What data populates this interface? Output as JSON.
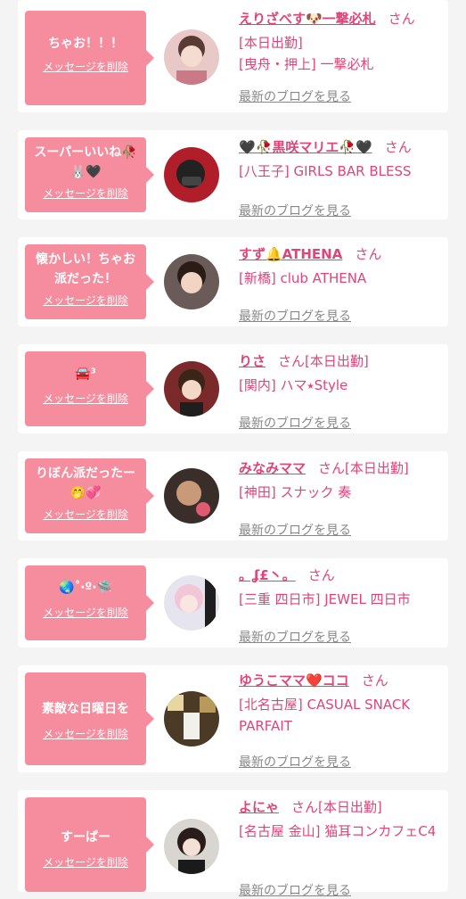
{
  "delete_label": "メッセージを削除",
  "blog_label": "最新のブログを見る",
  "san_label": "さん",
  "colors": {
    "bubble": "#f68d9e",
    "accent": "#e0457a",
    "link_gray": "#888888"
  },
  "cards": [
    {
      "message": "ちゃお！！！",
      "name": "えりざべす🐶一撃必札",
      "badge": "",
      "shop_lines": [
        "[本日出勤]",
        "[曳舟・押上] 一撃必札"
      ]
    },
    {
      "message": "スーパーいいね🥀🐰🖤",
      "name": "🖤🥀黒咲マリエ🥀🖤",
      "badge": "",
      "shop_lines": [
        "[八王子] GIRLS BAR BLESS"
      ]
    },
    {
      "message": "懐かしい！ちゃお派だった！",
      "name": "すず🔔ATHENA",
      "badge": "",
      "shop_lines": [
        "[新橋] club ATHENA"
      ]
    },
    {
      "message": "🚘³",
      "name": "りさ",
      "badge": "[本日出勤]",
      "shop_lines": [
        "[関内] ハマ⭑Style"
      ]
    },
    {
      "message": "りぼん派だったー🤭💞",
      "name": "みなみママ",
      "badge": "[本日出勤]",
      "shop_lines": [
        "[神田] スナック 奏"
      ]
    },
    {
      "message": "🌏˚‧º·🛸",
      "name": "。ʆ£丶。",
      "badge": "",
      "shop_lines": [
        "[三重 四日市] JEWEL 四日市"
      ]
    },
    {
      "message": "素敵な日曜日を",
      "name": "ゆうこママ❤️ココ",
      "badge": "",
      "shop_lines": [
        "[北名古屋] CASUAL SNACK PARFAIT"
      ]
    },
    {
      "message": "すーぱー",
      "name": "よにゃ",
      "badge": "[本日出勤]",
      "shop_lines": [
        "[名古屋 金山] 猫耳コンカフェC4"
      ]
    }
  ]
}
